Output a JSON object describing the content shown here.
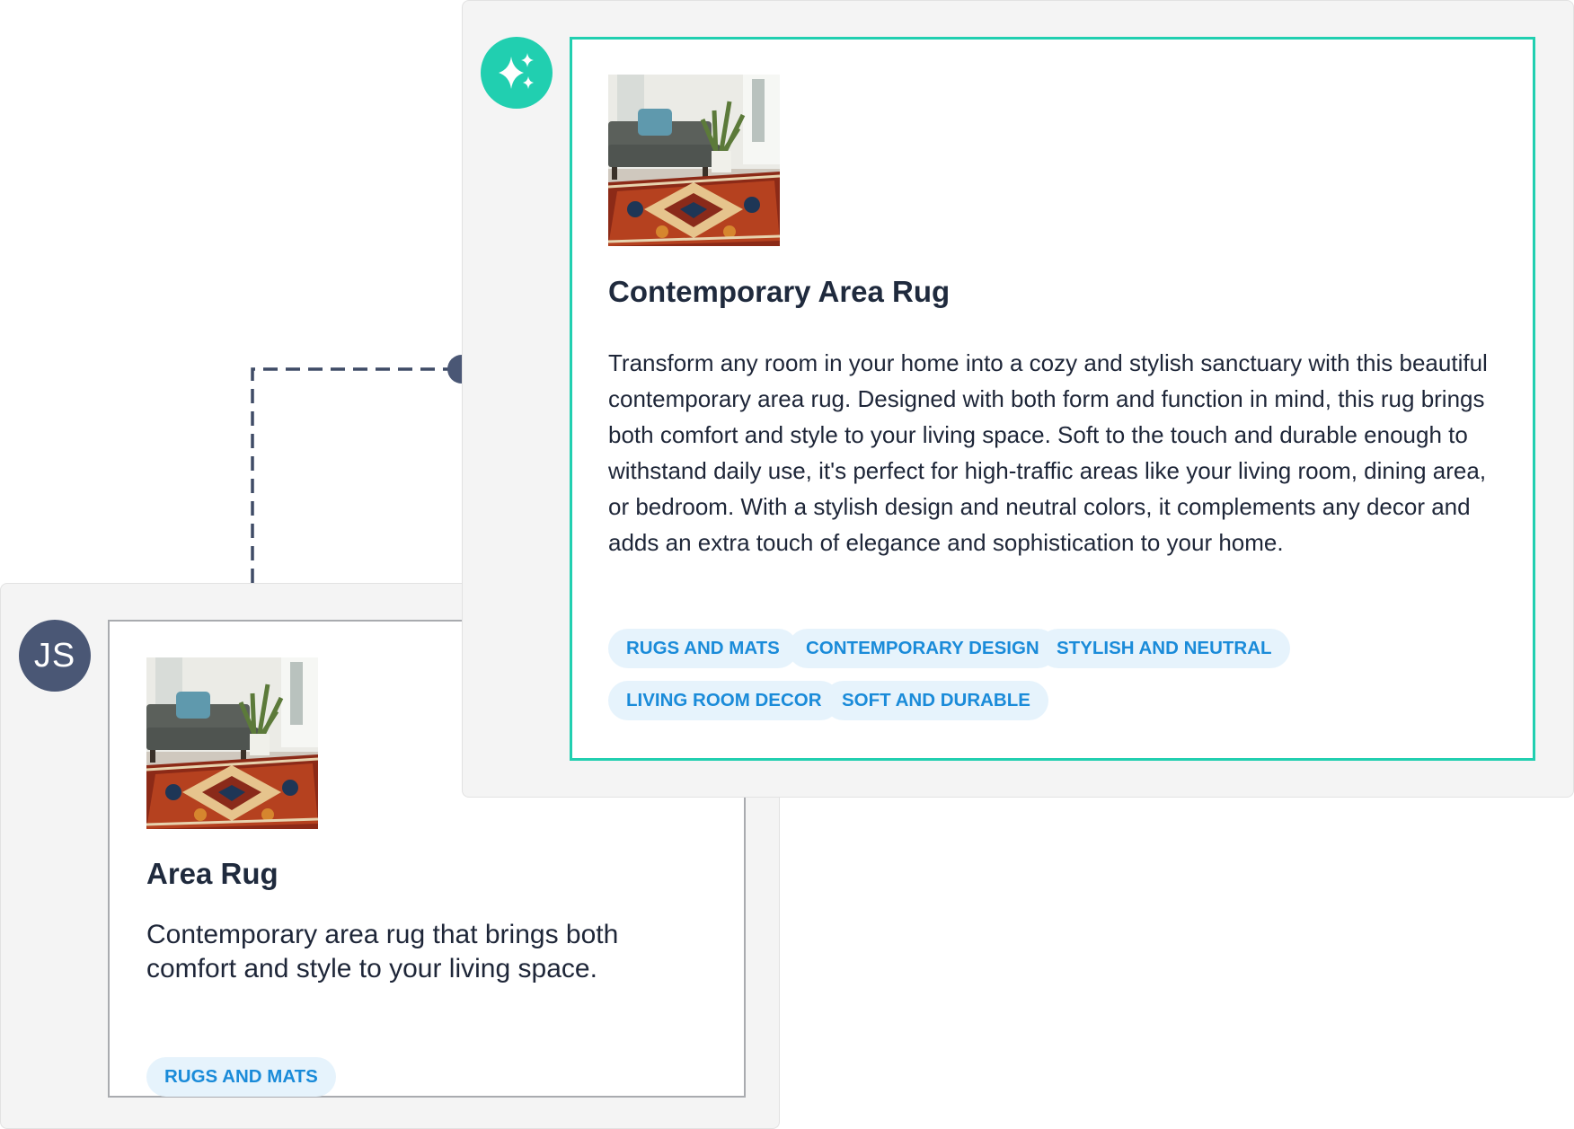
{
  "source": {
    "avatar_initials": "JS",
    "product": {
      "title": "Area Rug",
      "description": "Contemporary area rug that brings both comfort and style to your living space.",
      "tags": [
        "RUGS AND MATS"
      ]
    }
  },
  "generated": {
    "avatar_icon": "sparkles-icon",
    "product": {
      "title": "Contemporary Area Rug",
      "description": "Transform any room in your home into a cozy and stylish sanctuary with this beautiful contemporary area rug. Designed with both form and function in mind, this rug brings both comfort and style to your living space. Soft to the touch and durable enough to withstand daily use, it's perfect for high-traffic areas like your living room, dining area, or bedroom. With a stylish design and neutral colors, it complements any decor and adds an extra touch of elegance and sophistication to your home.",
      "tags": [
        "RUGS AND MATS",
        "CONTEMPORARY DESIGN",
        "STYLISH AND NEUTRAL",
        "LIVING ROOM DECOR",
        "SOFT AND DURABLE"
      ]
    }
  },
  "colors": {
    "accent": "#21cfb0",
    "avatar": "#4a5775",
    "tag_bg": "#e6f3fc",
    "tag_text": "#1a8bd9",
    "connector": "#3f4b66"
  }
}
